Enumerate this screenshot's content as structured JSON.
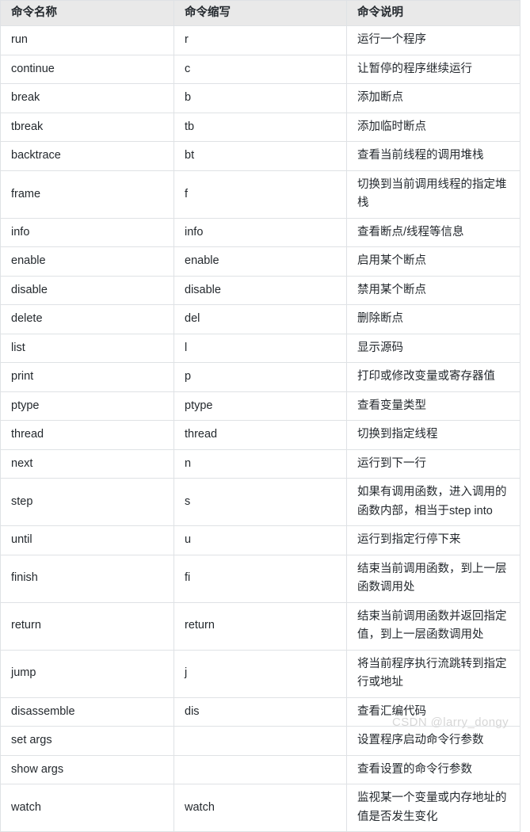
{
  "table": {
    "headers": [
      "命令名称",
      "命令缩写",
      "命令说明"
    ],
    "rows": [
      {
        "name": "run",
        "abbr": "r",
        "desc": "运行一个程序"
      },
      {
        "name": "continue",
        "abbr": "c",
        "desc": "让暂停的程序继续运行"
      },
      {
        "name": "break",
        "abbr": "b",
        "desc": "添加断点"
      },
      {
        "name": "tbreak",
        "abbr": "tb",
        "desc": "添加临时断点"
      },
      {
        "name": "backtrace",
        "abbr": "bt",
        "desc": "查看当前线程的调用堆栈"
      },
      {
        "name": "frame",
        "abbr": "f",
        "desc": "切换到当前调用线程的指定堆栈"
      },
      {
        "name": "info",
        "abbr": "info",
        "desc": "查看断点/线程等信息"
      },
      {
        "name": "enable",
        "abbr": "enable",
        "desc": "启用某个断点"
      },
      {
        "name": "disable",
        "abbr": "disable",
        "desc": "禁用某个断点"
      },
      {
        "name": "delete",
        "abbr": "del",
        "desc": "删除断点"
      },
      {
        "name": "list",
        "abbr": "l",
        "desc": "显示源码"
      },
      {
        "name": "print",
        "abbr": "p",
        "desc": "打印或修改变量或寄存器值"
      },
      {
        "name": "ptype",
        "abbr": "ptype",
        "desc": "查看变量类型"
      },
      {
        "name": "thread",
        "abbr": "thread",
        "desc": "切换到指定线程"
      },
      {
        "name": "next",
        "abbr": "n",
        "desc": "运行到下一行"
      },
      {
        "name": "step",
        "abbr": "s",
        "desc": "如果有调用函数，进入调用的函数内部，相当于step into"
      },
      {
        "name": "until",
        "abbr": "u",
        "desc": "运行到指定行停下来"
      },
      {
        "name": "finish",
        "abbr": "fi",
        "desc": "结束当前调用函数，到上一层函数调用处"
      },
      {
        "name": "return",
        "abbr": "return",
        "desc": "结束当前调用函数并返回指定值，到上一层函数调用处"
      },
      {
        "name": "jump",
        "abbr": "j",
        "desc": "将当前程序执行流跳转到指定行或地址"
      },
      {
        "name": "disassemble",
        "abbr": "dis",
        "desc": "查看汇编代码"
      },
      {
        "name": "set args",
        "abbr": "",
        "desc": "设置程序启动命令行参数"
      },
      {
        "name": "show args",
        "abbr": "",
        "desc": "查看设置的命令行参数"
      },
      {
        "name": "watch",
        "abbr": "watch",
        "desc": "监视某一个变量或内存地址的值是否发生变化"
      }
    ]
  },
  "watermark": {
    "text": "CSDN @larry_dongy",
    "color": "#d7d7d7"
  },
  "colors": {
    "header_bg": "#e9e9e9",
    "border": "#dfe2e5",
    "text": "#24292e",
    "cell_bg": "#ffffff"
  }
}
